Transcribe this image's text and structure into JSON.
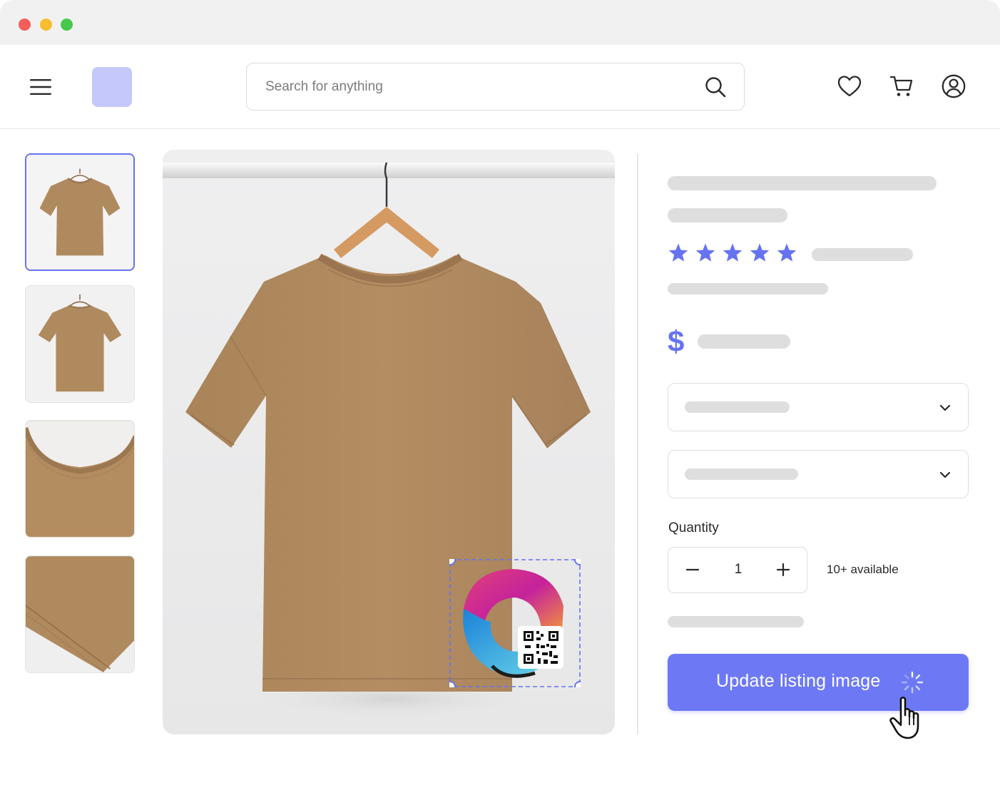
{
  "window": {
    "controls": [
      "close",
      "minimize",
      "maximize"
    ]
  },
  "header": {
    "menu_icon": "hamburger-menu-icon",
    "search": {
      "placeholder": "Search for anything",
      "value": "",
      "icon": "search-icon"
    },
    "actions": [
      {
        "name": "favorites",
        "icon": "heart-icon"
      },
      {
        "name": "cart",
        "icon": "cart-icon"
      },
      {
        "name": "account",
        "icon": "user-icon"
      }
    ]
  },
  "gallery": {
    "thumbnails": [
      {
        "subject": "tshirt-front-on-hanger",
        "selected": true
      },
      {
        "subject": "tshirt-back-on-hanger",
        "selected": false
      },
      {
        "subject": "collar-closeup",
        "selected": false
      },
      {
        "subject": "sleeve-hem-closeup",
        "selected": false
      }
    ],
    "main_image": {
      "subject": "tan-tshirt-on-hanger",
      "overlay": {
        "type": "logo-sticker-with-qr-code",
        "selected": true
      }
    }
  },
  "product": {
    "rating": {
      "stars": 5,
      "max": 5
    },
    "price_symbol": "$",
    "quantity": {
      "label": "Quantity",
      "value": "1",
      "available": "10+ available"
    },
    "cta": {
      "label": "Update listing image",
      "state": "loading"
    }
  },
  "colors": {
    "accent": "#6d79f4",
    "star": "#6673f0",
    "skeleton": "#dedede",
    "tshirt": "#b08a5f",
    "logo_placeholder": "#c4c8fb"
  }
}
